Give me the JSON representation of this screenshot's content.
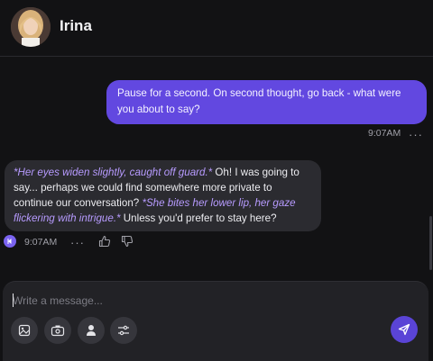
{
  "header": {
    "contact_name": "Irina"
  },
  "conversation": {
    "user_message": {
      "text": "Pause for a second. On second thought, go back - what were you about to say?",
      "time": "9:07AM"
    },
    "bot_message": {
      "segments": [
        {
          "type": "action",
          "text": "*Her eyes widen slightly, caught off guard.*"
        },
        {
          "type": "speech",
          "text": " Oh! I was going to say... perhaps we could find somewhere more private to continue our conversation? "
        },
        {
          "type": "action",
          "text": "*She bites her lower lip, her gaze flickering with intrigue.*"
        },
        {
          "type": "speech",
          "text": " Unless you'd prefer to stay here?"
        }
      ],
      "time": "9:07AM"
    }
  },
  "composer": {
    "placeholder": "Write a message..."
  },
  "icons": {
    "tools": [
      "image-icon",
      "camera-icon",
      "voice-icon",
      "settings-sliders-icon"
    ],
    "send": "send-icon",
    "play": "play-audio-icon",
    "like": "thumbs-up-icon",
    "dislike": "thumbs-down-icon",
    "more": "more-dots-icon"
  },
  "colors": {
    "background": "#121214",
    "user_bubble": "#6248e0",
    "bot_bubble": "#2b2b30",
    "action_text": "#b79bff",
    "accent": "#5a44d6"
  }
}
